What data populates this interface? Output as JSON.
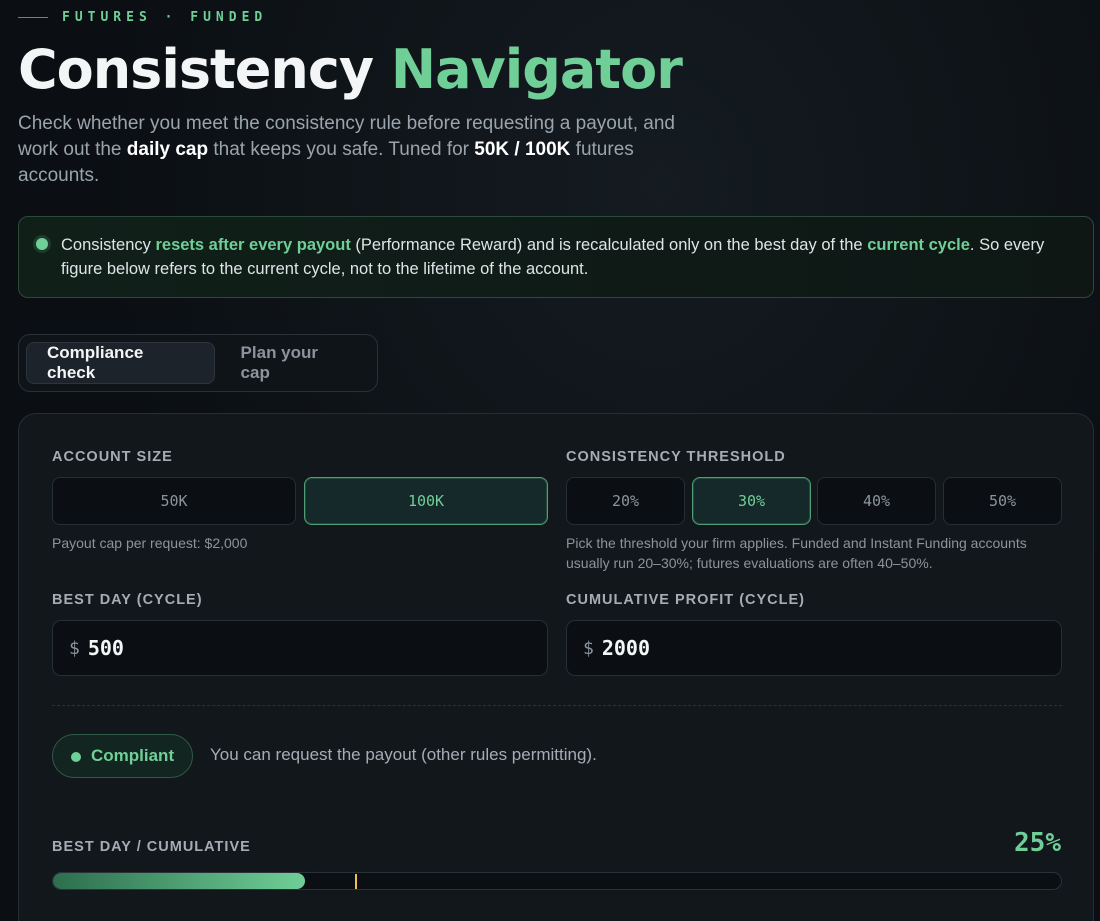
{
  "header": {
    "eyebrow": "FUTURES · FUNDED",
    "title_main": "Consistency",
    "title_accent": "Navigator",
    "intro_1": "Check whether you meet the consistency rule before requesting a payout, and work out the ",
    "intro_b1": "daily cap",
    "intro_2": " that keeps you safe. Tuned for ",
    "intro_b2": "50K / 100K",
    "intro_3": " futures accounts."
  },
  "notice": {
    "t1": "Consistency ",
    "h1": "resets after every payout",
    "t2": " (Performance Reward) and is recalculated only on the best day of the ",
    "h2": "current cycle",
    "t3": ". So every figure below refers to the current cycle, not to the lifetime of the account."
  },
  "tabs": [
    {
      "label": "Compliance check",
      "active": true
    },
    {
      "label": "Plan your cap",
      "active": false
    }
  ],
  "account": {
    "label": "ACCOUNT SIZE",
    "options": [
      "50K",
      "100K"
    ],
    "selected": "100K",
    "help": "Payout cap per request: $2,000"
  },
  "threshold": {
    "label": "CONSISTENCY THRESHOLD",
    "options": [
      "20%",
      "30%",
      "40%",
      "50%"
    ],
    "selected": "30%",
    "help": "Pick the threshold your firm applies. Funded and Instant Funding accounts usually run 20–30%; futures evaluations are often 40–50%."
  },
  "best_day": {
    "label": "BEST DAY (CYCLE)",
    "currency": "$",
    "value": "500"
  },
  "cumulative": {
    "label": "CUMULATIVE PROFIT (CYCLE)",
    "currency": "$",
    "value": "2000"
  },
  "result": {
    "badge": "Compliant",
    "message": "You can request the payout (other rules permitting).",
    "ratio_label": "BEST DAY / CUMULATIVE",
    "ratio_text": "25%",
    "ratio_value": 0.25,
    "threshold_value": 0.3
  },
  "colors": {
    "accent": "#6fcf97",
    "marker": "#e8c15a"
  }
}
